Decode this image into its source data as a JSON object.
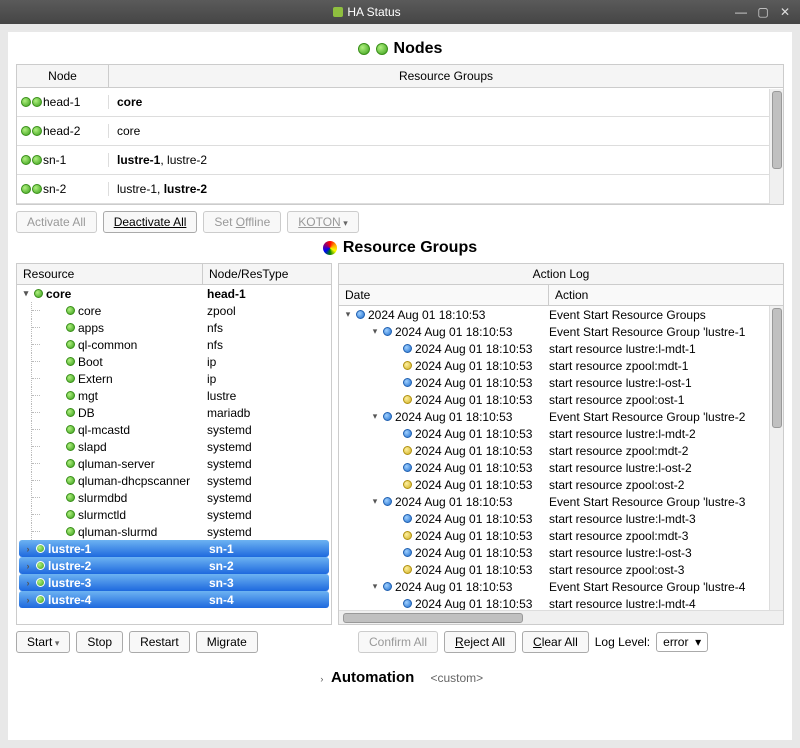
{
  "window": {
    "title": "HA Status"
  },
  "nodes_header": {
    "title": "Nodes",
    "col1": "Node",
    "col2": "Resource Groups"
  },
  "nodes": [
    {
      "name": "head-1",
      "rg_html": "<b>core</b>"
    },
    {
      "name": "head-2",
      "rg_html": "core"
    },
    {
      "name": "sn-1",
      "rg_html": "<b>lustre-1</b>, lustre-2"
    },
    {
      "name": "sn-2",
      "rg_html": "lustre-1, <b>lustre-2</b>"
    }
  ],
  "node_toolbar": {
    "activate": "Activate All",
    "deactivate": "Deactivate All",
    "offline_pre": "Set ",
    "offline_u": "O",
    "offline_post": "ffline",
    "dropdown": "KOTON"
  },
  "rg_header": {
    "title": "Resource Groups"
  },
  "res_pane": {
    "h1": "Resource",
    "h2": "Node/ResType"
  },
  "resources": {
    "root": {
      "name": "core",
      "node": "head-1"
    },
    "children": [
      {
        "name": "core",
        "type": "zpool"
      },
      {
        "name": "apps",
        "type": "nfs"
      },
      {
        "name": "ql-common",
        "type": "nfs"
      },
      {
        "name": "Boot",
        "type": "ip"
      },
      {
        "name": "Extern",
        "type": "ip"
      },
      {
        "name": "mgt",
        "type": "lustre"
      },
      {
        "name": "DB",
        "type": "mariadb"
      },
      {
        "name": "ql-mcastd",
        "type": "systemd"
      },
      {
        "name": "slapd",
        "type": "systemd"
      },
      {
        "name": "qluman-server",
        "type": "systemd"
      },
      {
        "name": "qluman-dhcpscanner",
        "type": "systemd"
      },
      {
        "name": "slurmdbd",
        "type": "systemd"
      },
      {
        "name": "slurmctld",
        "type": "systemd"
      },
      {
        "name": "qluman-slurmd",
        "type": "systemd"
      }
    ],
    "selected": [
      {
        "name": "lustre-1",
        "node": "sn-1"
      },
      {
        "name": "lustre-2",
        "node": "sn-2"
      },
      {
        "name": "lustre-3",
        "node": "sn-3"
      },
      {
        "name": "lustre-4",
        "node": "sn-4"
      }
    ]
  },
  "log_pane": {
    "title": "Action Log",
    "h1": "Date",
    "h2": "Action"
  },
  "log": [
    {
      "lvl": 0,
      "caret": "▾",
      "color": "blue",
      "ts": "2024 Aug 01 18:10:53",
      "act": "Event Start Resource Groups"
    },
    {
      "lvl": 1,
      "caret": "▾",
      "color": "blue",
      "ts": "2024 Aug 01 18:10:53",
      "act": "Event Start Resource Group 'lustre-1"
    },
    {
      "lvl": 2,
      "caret": "",
      "color": "blue",
      "ts": "2024 Aug 01 18:10:53",
      "act": "start resource lustre:l-mdt-1"
    },
    {
      "lvl": 2,
      "caret": "",
      "color": "yellow",
      "ts": "2024 Aug 01 18:10:53",
      "act": "start resource zpool:mdt-1"
    },
    {
      "lvl": 2,
      "caret": "",
      "color": "blue",
      "ts": "2024 Aug 01 18:10:53",
      "act": "start resource lustre:l-ost-1"
    },
    {
      "lvl": 2,
      "caret": "",
      "color": "yellow",
      "ts": "2024 Aug 01 18:10:53",
      "act": "start resource zpool:ost-1"
    },
    {
      "lvl": 1,
      "caret": "▾",
      "color": "blue",
      "ts": "2024 Aug 01 18:10:53",
      "act": "Event Start Resource Group 'lustre-2"
    },
    {
      "lvl": 2,
      "caret": "",
      "color": "blue",
      "ts": "2024 Aug 01 18:10:53",
      "act": "start resource lustre:l-mdt-2"
    },
    {
      "lvl": 2,
      "caret": "",
      "color": "yellow",
      "ts": "2024 Aug 01 18:10:53",
      "act": "start resource zpool:mdt-2"
    },
    {
      "lvl": 2,
      "caret": "",
      "color": "blue",
      "ts": "2024 Aug 01 18:10:53",
      "act": "start resource lustre:l-ost-2"
    },
    {
      "lvl": 2,
      "caret": "",
      "color": "yellow",
      "ts": "2024 Aug 01 18:10:53",
      "act": "start resource zpool:ost-2"
    },
    {
      "lvl": 1,
      "caret": "▾",
      "color": "blue",
      "ts": "2024 Aug 01 18:10:53",
      "act": "Event Start Resource Group 'lustre-3"
    },
    {
      "lvl": 2,
      "caret": "",
      "color": "blue",
      "ts": "2024 Aug 01 18:10:53",
      "act": "start resource lustre:l-mdt-3"
    },
    {
      "lvl": 2,
      "caret": "",
      "color": "yellow",
      "ts": "2024 Aug 01 18:10:53",
      "act": "start resource zpool:mdt-3"
    },
    {
      "lvl": 2,
      "caret": "",
      "color": "blue",
      "ts": "2024 Aug 01 18:10:53",
      "act": "start resource lustre:l-ost-3"
    },
    {
      "lvl": 2,
      "caret": "",
      "color": "yellow",
      "ts": "2024 Aug 01 18:10:53",
      "act": "start resource zpool:ost-3"
    },
    {
      "lvl": 1,
      "caret": "▾",
      "color": "blue",
      "ts": "2024 Aug 01 18:10:53",
      "act": "Event Start Resource Group 'lustre-4"
    },
    {
      "lvl": 2,
      "caret": "",
      "color": "blue",
      "ts": "2024 Aug 01 18:10:53",
      "act": "start resource lustre:l-mdt-4"
    }
  ],
  "res_toolbar": {
    "start": "Start",
    "stop": "Stop",
    "restart": "Restart",
    "migrate": "Migrate"
  },
  "log_toolbar": {
    "confirm": "Confirm All",
    "reject_u": "R",
    "reject_post": "eject All",
    "clear_u": "C",
    "clear_post": "lear All",
    "loglevel_label": "Log Level:",
    "loglevel_value": "error"
  },
  "automation": {
    "label": "Automation",
    "custom": "<custom>"
  }
}
